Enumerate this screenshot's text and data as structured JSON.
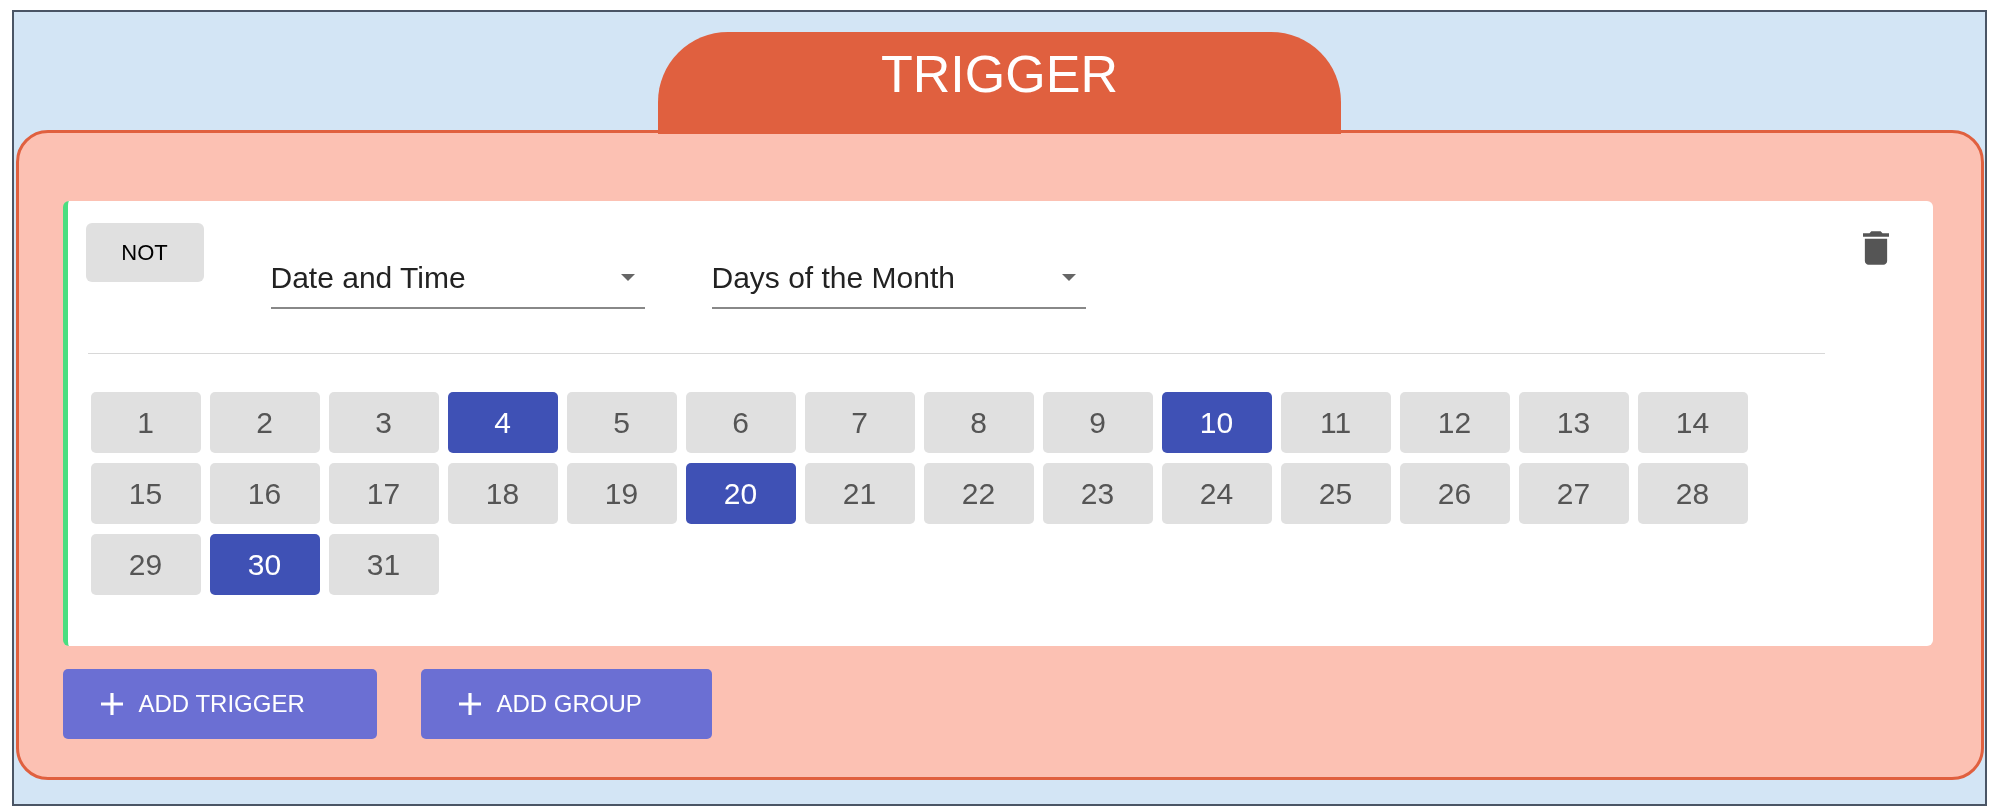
{
  "panel": {
    "title": "TRIGGER"
  },
  "condition": {
    "not_button": "NOT",
    "selects": [
      {
        "value": "Date and Time"
      },
      {
        "value": "Days of the Month"
      }
    ],
    "days": [
      {
        "label": "1",
        "selected": false
      },
      {
        "label": "2",
        "selected": false
      },
      {
        "label": "3",
        "selected": false
      },
      {
        "label": "4",
        "selected": true
      },
      {
        "label": "5",
        "selected": false
      },
      {
        "label": "6",
        "selected": false
      },
      {
        "label": "7",
        "selected": false
      },
      {
        "label": "8",
        "selected": false
      },
      {
        "label": "9",
        "selected": false
      },
      {
        "label": "10",
        "selected": true
      },
      {
        "label": "11",
        "selected": false
      },
      {
        "label": "12",
        "selected": false
      },
      {
        "label": "13",
        "selected": false
      },
      {
        "label": "14",
        "selected": false
      },
      {
        "label": "15",
        "selected": false
      },
      {
        "label": "16",
        "selected": false
      },
      {
        "label": "17",
        "selected": false
      },
      {
        "label": "18",
        "selected": false
      },
      {
        "label": "19",
        "selected": false
      },
      {
        "label": "20",
        "selected": true
      },
      {
        "label": "21",
        "selected": false
      },
      {
        "label": "22",
        "selected": false
      },
      {
        "label": "23",
        "selected": false
      },
      {
        "label": "24",
        "selected": false
      },
      {
        "label": "25",
        "selected": false
      },
      {
        "label": "26",
        "selected": false
      },
      {
        "label": "27",
        "selected": false
      },
      {
        "label": "28",
        "selected": false
      },
      {
        "label": "29",
        "selected": false
      },
      {
        "label": "30",
        "selected": true
      },
      {
        "label": "31",
        "selected": false
      }
    ]
  },
  "actions": [
    {
      "label": "ADD TRIGGER"
    },
    {
      "label": "ADD GROUP"
    }
  ]
}
